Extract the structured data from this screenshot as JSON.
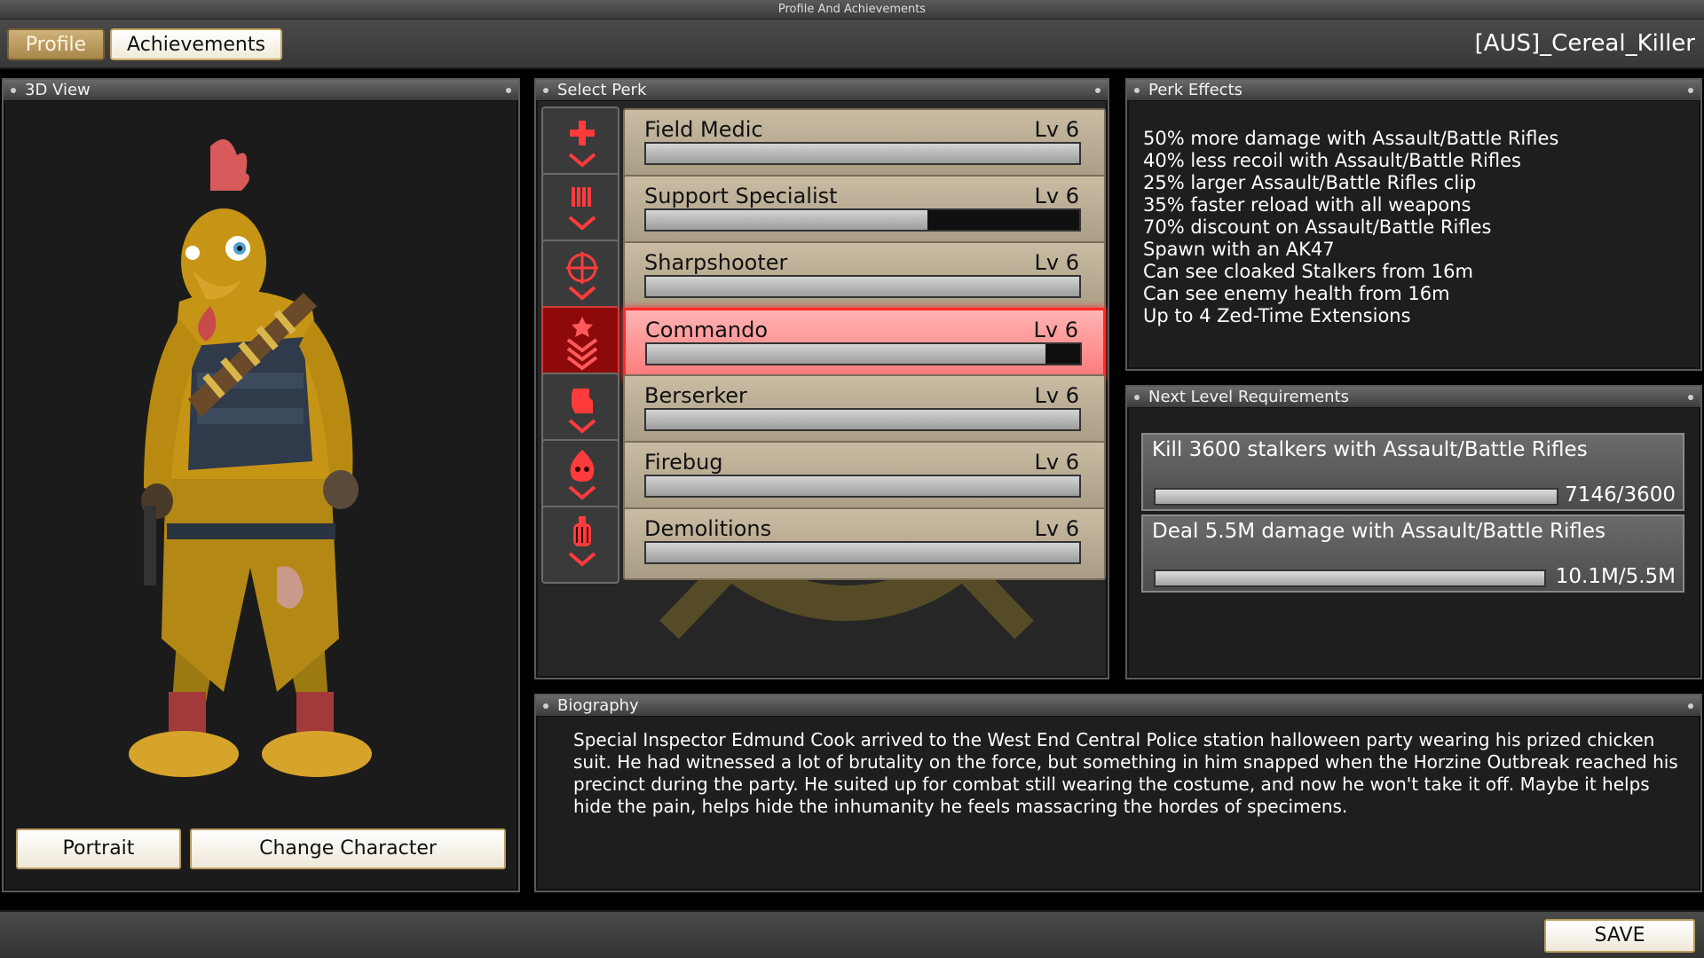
{
  "window": {
    "title": "Profile And Achievements"
  },
  "tabs": [
    {
      "label": "Profile",
      "active": true
    },
    {
      "label": "Achievements",
      "active": false
    }
  ],
  "player": {
    "name": "[AUS]_Cereal_Killer"
  },
  "view3d": {
    "title": "3D View",
    "character": "chicken-suit-character",
    "buttons": {
      "portrait": "Portrait",
      "change": "Change Character"
    }
  },
  "perks": {
    "title": "Select Perk",
    "items": [
      {
        "name": "Field Medic",
        "level": "Lv 6",
        "progress": 1.0,
        "icon": "medic-cross-icon",
        "selected": false
      },
      {
        "name": "Support Specialist",
        "level": "Lv 6",
        "progress": 0.65,
        "icon": "shotgun-shells-icon",
        "selected": false
      },
      {
        "name": "Sharpshooter",
        "level": "Lv 6",
        "progress": 1.0,
        "icon": "crosshair-icon",
        "selected": false
      },
      {
        "name": "Commando",
        "level": "Lv 6",
        "progress": 0.92,
        "icon": "chevron-star-icon",
        "selected": true
      },
      {
        "name": "Berserker",
        "level": "Lv 6",
        "progress": 1.0,
        "icon": "fist-icon",
        "selected": false
      },
      {
        "name": "Firebug",
        "level": "Lv 6",
        "progress": 1.0,
        "icon": "flame-skull-icon",
        "selected": false
      },
      {
        "name": "Demolitions",
        "level": "Lv 6",
        "progress": 1.0,
        "icon": "grenade-icon",
        "selected": false
      }
    ]
  },
  "effects": {
    "title": "Perk Effects",
    "lines": [
      "50% more damage with Assault/Battle Rifles",
      "40% less recoil with Assault/Battle Rifles",
      "25% larger Assault/Battle Rifles clip",
      "35% faster reload with all weapons",
      "70% discount on Assault/Battle Rifles",
      "Spawn with an AK47",
      "Can see cloaked Stalkers from 16m",
      "Can see enemy health from 16m",
      "Up to 4 Zed-Time Extensions"
    ]
  },
  "requirements": {
    "title": "Next Level Requirements",
    "items": [
      {
        "text": "Kill 3600 stalkers with Assault/Battle Rifles",
        "count": "7146/3600",
        "progress": 1.0
      },
      {
        "text": "Deal 5.5M damage with Assault/Battle Rifles",
        "count": "10.1M/5.5M",
        "progress": 1.0
      }
    ]
  },
  "biography": {
    "title": "Biography",
    "text": "Special Inspector Edmund Cook arrived to the West End Central Police station halloween party wearing his prized chicken suit. He had witnessed a lot of brutality on the force, but something in him snapped when the Horzine Outbreak reached his precinct during the party. He suited up for combat still wearing the costume, and now he won't take it off. Maybe it helps hide the pain, helps hide the inhumanity he feels massacring the hordes of specimens."
  },
  "footer": {
    "save": "SAVE"
  },
  "colors": {
    "accent_red": "#ff2a2a",
    "tab_gold": "#c9a860",
    "panel_bg": "#1e1e1e"
  }
}
